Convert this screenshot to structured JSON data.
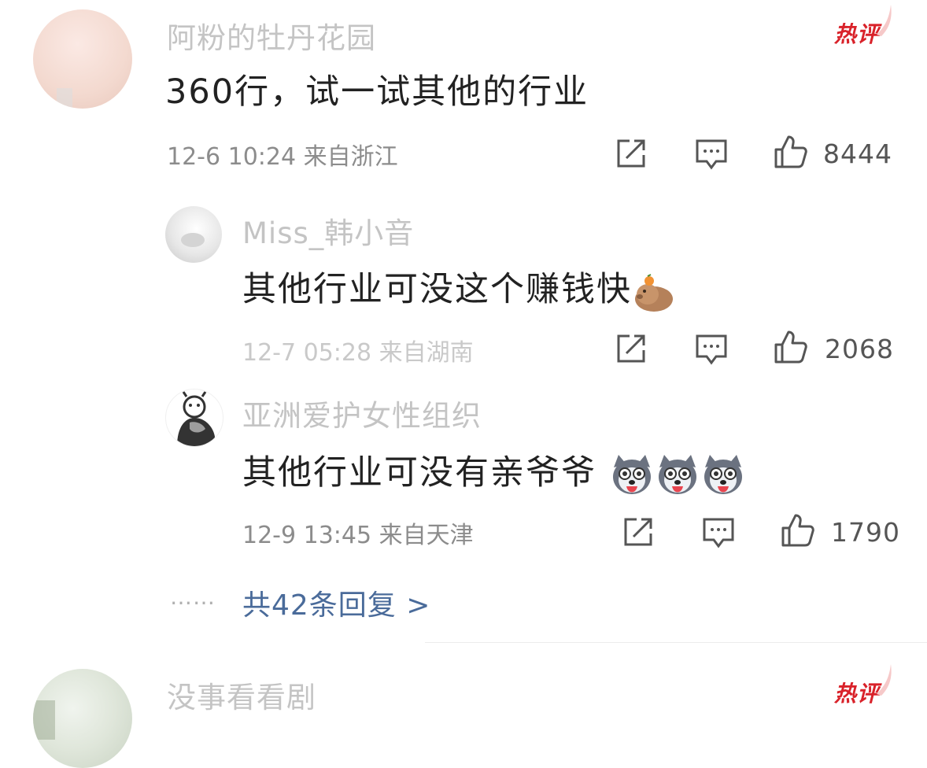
{
  "comments": [
    {
      "username": "阿粉的牡丹花园",
      "text": "360行，试一试其他的行业",
      "date": "12-6 10:24",
      "location": "来自浙江",
      "likes": "8444",
      "badge": "热评"
    }
  ],
  "replies": [
    {
      "username": "Miss_韩小音",
      "text": "其他行业可没这个赚钱快",
      "date": "12-7 05:28",
      "location": "来自湖南",
      "likes": "2068",
      "emoji": "capybara-emoji"
    },
    {
      "username": "亚洲爱护女性组织",
      "text": "其他行业可没有亲爷爷",
      "date": "12-9 13:45",
      "location": "来自天津",
      "likes": "1790",
      "emoji": "husky-emoji"
    }
  ],
  "more_replies": {
    "dots": "……",
    "label": "共42条回复 >"
  },
  "next_comment": {
    "username": "没事看看剧",
    "badge": "热评"
  },
  "colors": {
    "badge_red": "#d9222a",
    "link_blue": "#4a6b9a",
    "username_gray": "#c4c4c4",
    "meta_gray": "#8c8c8c"
  }
}
